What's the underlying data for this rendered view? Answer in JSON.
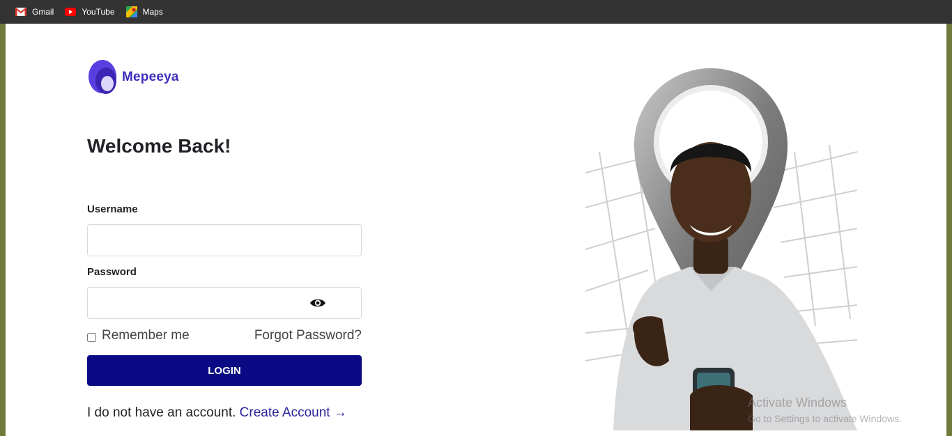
{
  "bookmarks": [
    {
      "label": "Gmail",
      "icon": "gmail-icon"
    },
    {
      "label": "YouTube",
      "icon": "youtube-icon"
    },
    {
      "label": "Maps",
      "icon": "maps-icon"
    }
  ],
  "brand": {
    "name": "Mepeeya",
    "color": "#3f2dbf"
  },
  "form": {
    "title": "Welcome Back!",
    "username_label": "Username",
    "username_value": "",
    "password_label": "Password",
    "password_value": "",
    "remember_label": "Remember me",
    "remember_checked": false,
    "forgot_label": "Forgot Password?",
    "login_label": "LOGIN",
    "login_color": "#0a0a84",
    "signup_text": "I do not have an account.",
    "signup_link": "Create Account",
    "signup_arrow": "→",
    "eye_icon": "eye-icon"
  },
  "watermark": {
    "title": "Activate Windows",
    "subtitle": "Go to Settings to activate Windows."
  }
}
